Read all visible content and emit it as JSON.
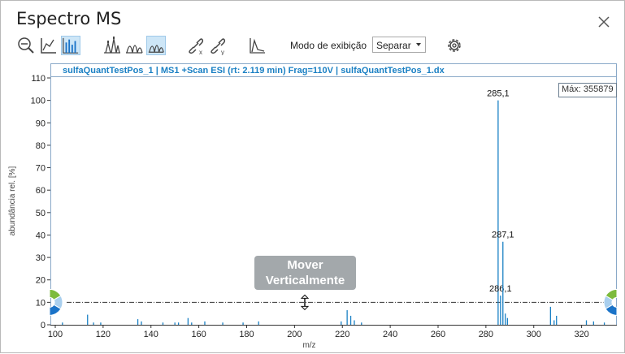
{
  "window": {
    "title": "Espectro MS"
  },
  "toolbar": {
    "mode_label": "Modo de exibição",
    "mode_value": "Separar"
  },
  "plot": {
    "header": "sulfaQuantTestPos_1 | MS1 +Scan ESI (rt: 2.119 min) Frag=110V | sulfaQuantTestPos_1.dx",
    "max_label": "Máx: 355879",
    "tooltip": [
      "Mover",
      "Verticalmente"
    ],
    "colors": {
      "stick": "#1a80c4",
      "header_text": "#1a80c4",
      "handle_green": "#7dbb3d",
      "handle_blue": "#1a73c8"
    }
  },
  "chart_data": {
    "type": "bar",
    "xlabel": "m/z",
    "ylabel": "abundância rel. [%]",
    "xlim": [
      100,
      331
    ],
    "ylim": [
      0,
      110
    ],
    "x_ticks": [
      100,
      120,
      140,
      160,
      180,
      200,
      220,
      240,
      260,
      280,
      300,
      320
    ],
    "y_ticks": [
      0,
      10,
      20,
      30,
      40,
      50,
      60,
      70,
      80,
      90,
      100,
      110
    ],
    "threshold_y": 10,
    "peaks": [
      {
        "x": 103,
        "y": 1
      },
      {
        "x": 113.5,
        "y": 4.5
      },
      {
        "x": 116,
        "y": 1
      },
      {
        "x": 119,
        "y": 1
      },
      {
        "x": 134.5,
        "y": 2.5
      },
      {
        "x": 136,
        "y": 1.5
      },
      {
        "x": 145,
        "y": 1
      },
      {
        "x": 150,
        "y": 1
      },
      {
        "x": 151.5,
        "y": 1
      },
      {
        "x": 155.5,
        "y": 3
      },
      {
        "x": 157,
        "y": 1
      },
      {
        "x": 162.5,
        "y": 1.5
      },
      {
        "x": 170,
        "y": 1
      },
      {
        "x": 178.5,
        "y": 1
      },
      {
        "x": 185,
        "y": 1.5
      },
      {
        "x": 219.5,
        "y": 1.5
      },
      {
        "x": 222,
        "y": 6.5
      },
      {
        "x": 223.5,
        "y": 4
      },
      {
        "x": 225,
        "y": 2
      },
      {
        "x": 228,
        "y": 1
      },
      {
        "x": 285.1,
        "y": 100,
        "label": "285,1"
      },
      {
        "x": 286.1,
        "y": 13,
        "label": "286,1"
      },
      {
        "x": 287.1,
        "y": 37,
        "label": "287,1"
      },
      {
        "x": 288.1,
        "y": 5
      },
      {
        "x": 289,
        "y": 3
      },
      {
        "x": 307,
        "y": 8
      },
      {
        "x": 308.5,
        "y": 2
      },
      {
        "x": 309.5,
        "y": 4
      },
      {
        "x": 322,
        "y": 2
      },
      {
        "x": 325,
        "y": 1.5
      },
      {
        "x": 329.5,
        "y": 1
      }
    ]
  }
}
